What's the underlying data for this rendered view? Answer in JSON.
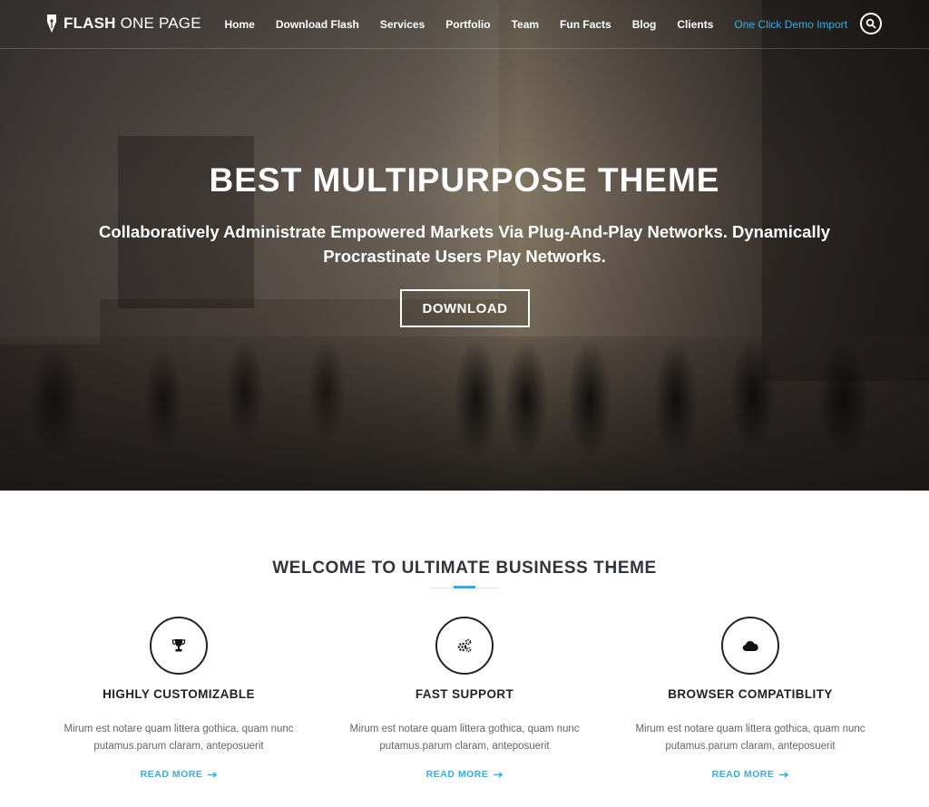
{
  "brand": {
    "name_bold": "FLASH",
    "name_light": "ONE PAGE"
  },
  "nav": {
    "items": [
      {
        "label": "Home"
      },
      {
        "label": "Download Flash"
      },
      {
        "label": "Services"
      },
      {
        "label": "Portfolio"
      },
      {
        "label": "Team"
      },
      {
        "label": "Fun Facts"
      },
      {
        "label": "Blog"
      },
      {
        "label": "Clients"
      },
      {
        "label": "One Click Demo Import"
      }
    ],
    "active_color": "#30afe6",
    "search_icon": "search-icon"
  },
  "hero": {
    "title": "BEST MULTIPURPOSE THEME",
    "subtitle": "Collaboratively Administrate Empowered Markets Via Plug-And-Play Networks. Dynamically Procrastinate Users Play Networks.",
    "button": "DOWNLOAD"
  },
  "welcome": {
    "title": "WELCOME TO ULTIMATE BUSINESS THEME",
    "accent_color": "#30afe6",
    "features": [
      {
        "icon": "trophy-icon",
        "title": "HIGHLY CUSTOMIZABLE",
        "desc": "Mirum est notare quam littera gothica, quam nunc putamus.parum claram, anteposuerit",
        "more": "READ MORE"
      },
      {
        "icon": "gears-icon",
        "title": "FAST SUPPORT",
        "desc": "Mirum est notare quam littera gothica, quam nunc putamus.parum claram, anteposuerit",
        "more": "READ MORE"
      },
      {
        "icon": "cloud-icon",
        "title": "BROWSER COMPATIBLITY",
        "desc": "Mirum est notare quam littera gothica, quam nunc putamus.parum claram, anteposuerit",
        "more": "READ MORE"
      }
    ]
  }
}
